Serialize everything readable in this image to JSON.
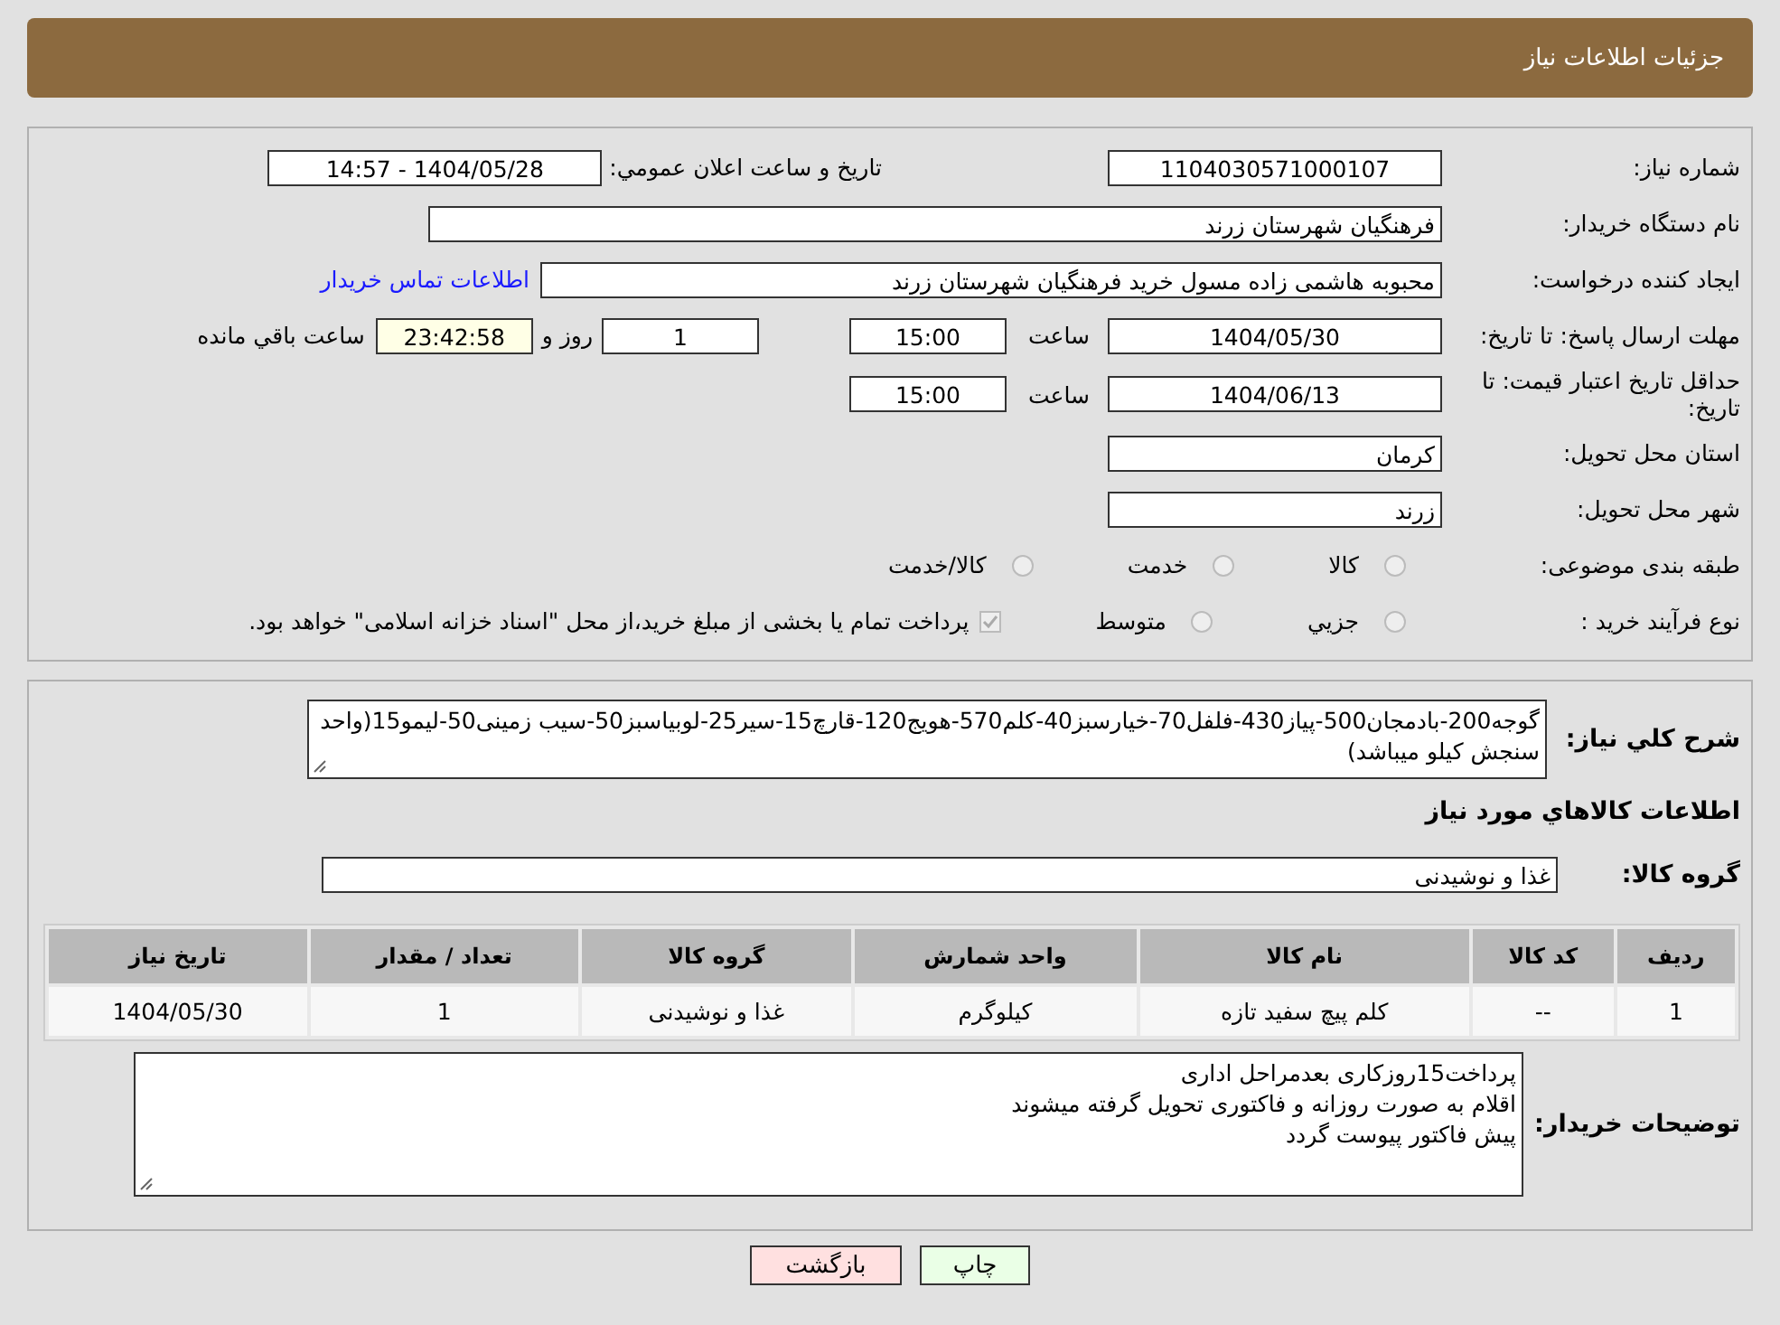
{
  "header": {
    "title": "جزئیات اطلاعات نیاز"
  },
  "details": {
    "need_number": {
      "label": "شماره نياز:",
      "value": "1104030571000107"
    },
    "announce": {
      "label": "تاريخ و ساعت اعلان عمومي:",
      "value": "1404/05/28 - 14:57"
    },
    "buyer": {
      "label": "نام دستگاه خريدار:",
      "value": "فرهنگيان شهرستان زرند"
    },
    "creator": {
      "label": "ايجاد كننده درخواست:",
      "value": "محبوبه هاشمی زاده مسول خرید فرهنگیان شهرستان زرند",
      "link": "اطلاعات تماس خريدار"
    },
    "deadline": {
      "label": "مهلت ارسال پاسخ: تا تاريخ:",
      "date": "1404/05/30",
      "time_label": "ساعت",
      "time": "15:00",
      "days": "1",
      "days_label": "روز و",
      "remaining": "23:42:58",
      "remaining_label": "ساعت باقي مانده"
    },
    "validity": {
      "label": "حداقل تاريخ اعتبار قيمت: تا تاريخ:",
      "date": "1404/06/13",
      "time_label": "ساعت",
      "time": "15:00"
    },
    "province": {
      "label": "استان محل تحويل:",
      "value": "كرمان"
    },
    "city": {
      "label": "شهر محل تحويل:",
      "value": "زرند"
    },
    "category": {
      "label": "طبقه بندی موضوعی:",
      "options": [
        {
          "label": "كالا",
          "selected": false
        },
        {
          "label": "خدمت",
          "selected": false
        },
        {
          "label": "كالا/خدمت",
          "selected": false
        }
      ]
    },
    "process": {
      "label": "نوع فرآيند خريد :",
      "options": [
        {
          "label": "جزيي",
          "selected": false
        },
        {
          "label": "متوسط",
          "selected": false
        }
      ],
      "checkbox": {
        "label": "پرداخت تمام يا بخشی از مبلغ خريد،از محل \"اسناد خزانه اسلامی\" خواهد بود.",
        "checked": true
      }
    }
  },
  "goods": {
    "description": {
      "label": "شرح كلي نياز:",
      "value": "گوجه200-بادمجان500-پیاز430-فلفل70-خیارسبز40-کلم570-هویج120-قارچ15-سیر25-لوبیاسبز50-سیب زمینی50-لیمو15(واحد سنجش کیلو میباشد)"
    },
    "heading": "اطلاعات كالاهاي مورد نياز",
    "group": {
      "label": "گروه كالا:",
      "value": "غذا و نوشیدنی"
    },
    "table": {
      "columns": [
        "رديف",
        "كد كالا",
        "نام كالا",
        "واحد شمارش",
        "گروه كالا",
        "تعداد / مقدار",
        "تاريخ نياز"
      ],
      "rows": [
        [
          "1",
          "--",
          "كلم پيچ سفيد تازه",
          "كيلوگرم",
          "غذا و نوشیدنی",
          "1",
          "1404/05/30"
        ]
      ]
    },
    "notes": {
      "label": "توضيحات خريدار:",
      "value": "پرداخت15روزکاری بعدمراحل اداری\nاقلام به صورت روزانه و فاکتوری تحویل گرفته میشوند\nپیش فاکتور پیوست گردد"
    }
  },
  "buttons": [
    {
      "label": "چاپ",
      "kind": "print"
    },
    {
      "label": "بازگشت",
      "kind": "back"
    }
  ]
}
